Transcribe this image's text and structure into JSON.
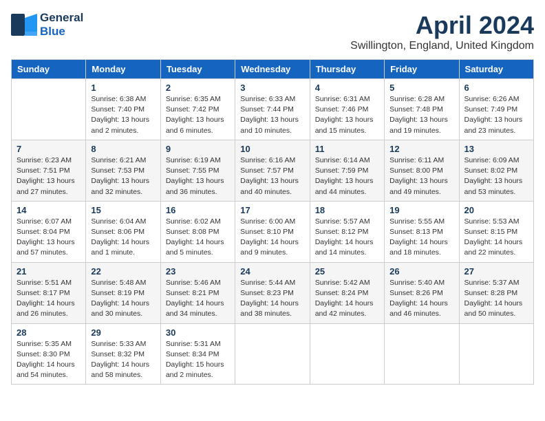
{
  "header": {
    "logo_line1": "General",
    "logo_line2": "Blue",
    "month": "April 2024",
    "location": "Swillington, England, United Kingdom"
  },
  "weekdays": [
    "Sunday",
    "Monday",
    "Tuesday",
    "Wednesday",
    "Thursday",
    "Friday",
    "Saturday"
  ],
  "weeks": [
    [
      {
        "day": "",
        "info": ""
      },
      {
        "day": "1",
        "info": "Sunrise: 6:38 AM\nSunset: 7:40 PM\nDaylight: 13 hours\nand 2 minutes."
      },
      {
        "day": "2",
        "info": "Sunrise: 6:35 AM\nSunset: 7:42 PM\nDaylight: 13 hours\nand 6 minutes."
      },
      {
        "day": "3",
        "info": "Sunrise: 6:33 AM\nSunset: 7:44 PM\nDaylight: 13 hours\nand 10 minutes."
      },
      {
        "day": "4",
        "info": "Sunrise: 6:31 AM\nSunset: 7:46 PM\nDaylight: 13 hours\nand 15 minutes."
      },
      {
        "day": "5",
        "info": "Sunrise: 6:28 AM\nSunset: 7:48 PM\nDaylight: 13 hours\nand 19 minutes."
      },
      {
        "day": "6",
        "info": "Sunrise: 6:26 AM\nSunset: 7:49 PM\nDaylight: 13 hours\nand 23 minutes."
      }
    ],
    [
      {
        "day": "7",
        "info": "Sunrise: 6:23 AM\nSunset: 7:51 PM\nDaylight: 13 hours\nand 27 minutes."
      },
      {
        "day": "8",
        "info": "Sunrise: 6:21 AM\nSunset: 7:53 PM\nDaylight: 13 hours\nand 32 minutes."
      },
      {
        "day": "9",
        "info": "Sunrise: 6:19 AM\nSunset: 7:55 PM\nDaylight: 13 hours\nand 36 minutes."
      },
      {
        "day": "10",
        "info": "Sunrise: 6:16 AM\nSunset: 7:57 PM\nDaylight: 13 hours\nand 40 minutes."
      },
      {
        "day": "11",
        "info": "Sunrise: 6:14 AM\nSunset: 7:59 PM\nDaylight: 13 hours\nand 44 minutes."
      },
      {
        "day": "12",
        "info": "Sunrise: 6:11 AM\nSunset: 8:00 PM\nDaylight: 13 hours\nand 49 minutes."
      },
      {
        "day": "13",
        "info": "Sunrise: 6:09 AM\nSunset: 8:02 PM\nDaylight: 13 hours\nand 53 minutes."
      }
    ],
    [
      {
        "day": "14",
        "info": "Sunrise: 6:07 AM\nSunset: 8:04 PM\nDaylight: 13 hours\nand 57 minutes."
      },
      {
        "day": "15",
        "info": "Sunrise: 6:04 AM\nSunset: 8:06 PM\nDaylight: 14 hours\nand 1 minute."
      },
      {
        "day": "16",
        "info": "Sunrise: 6:02 AM\nSunset: 8:08 PM\nDaylight: 14 hours\nand 5 minutes."
      },
      {
        "day": "17",
        "info": "Sunrise: 6:00 AM\nSunset: 8:10 PM\nDaylight: 14 hours\nand 9 minutes."
      },
      {
        "day": "18",
        "info": "Sunrise: 5:57 AM\nSunset: 8:12 PM\nDaylight: 14 hours\nand 14 minutes."
      },
      {
        "day": "19",
        "info": "Sunrise: 5:55 AM\nSunset: 8:13 PM\nDaylight: 14 hours\nand 18 minutes."
      },
      {
        "day": "20",
        "info": "Sunrise: 5:53 AM\nSunset: 8:15 PM\nDaylight: 14 hours\nand 22 minutes."
      }
    ],
    [
      {
        "day": "21",
        "info": "Sunrise: 5:51 AM\nSunset: 8:17 PM\nDaylight: 14 hours\nand 26 minutes."
      },
      {
        "day": "22",
        "info": "Sunrise: 5:48 AM\nSunset: 8:19 PM\nDaylight: 14 hours\nand 30 minutes."
      },
      {
        "day": "23",
        "info": "Sunrise: 5:46 AM\nSunset: 8:21 PM\nDaylight: 14 hours\nand 34 minutes."
      },
      {
        "day": "24",
        "info": "Sunrise: 5:44 AM\nSunset: 8:23 PM\nDaylight: 14 hours\nand 38 minutes."
      },
      {
        "day": "25",
        "info": "Sunrise: 5:42 AM\nSunset: 8:24 PM\nDaylight: 14 hours\nand 42 minutes."
      },
      {
        "day": "26",
        "info": "Sunrise: 5:40 AM\nSunset: 8:26 PM\nDaylight: 14 hours\nand 46 minutes."
      },
      {
        "day": "27",
        "info": "Sunrise: 5:37 AM\nSunset: 8:28 PM\nDaylight: 14 hours\nand 50 minutes."
      }
    ],
    [
      {
        "day": "28",
        "info": "Sunrise: 5:35 AM\nSunset: 8:30 PM\nDaylight: 14 hours\nand 54 minutes."
      },
      {
        "day": "29",
        "info": "Sunrise: 5:33 AM\nSunset: 8:32 PM\nDaylight: 14 hours\nand 58 minutes."
      },
      {
        "day": "30",
        "info": "Sunrise: 5:31 AM\nSunset: 8:34 PM\nDaylight: 15 hours\nand 2 minutes."
      },
      {
        "day": "",
        "info": ""
      },
      {
        "day": "",
        "info": ""
      },
      {
        "day": "",
        "info": ""
      },
      {
        "day": "",
        "info": ""
      }
    ]
  ]
}
